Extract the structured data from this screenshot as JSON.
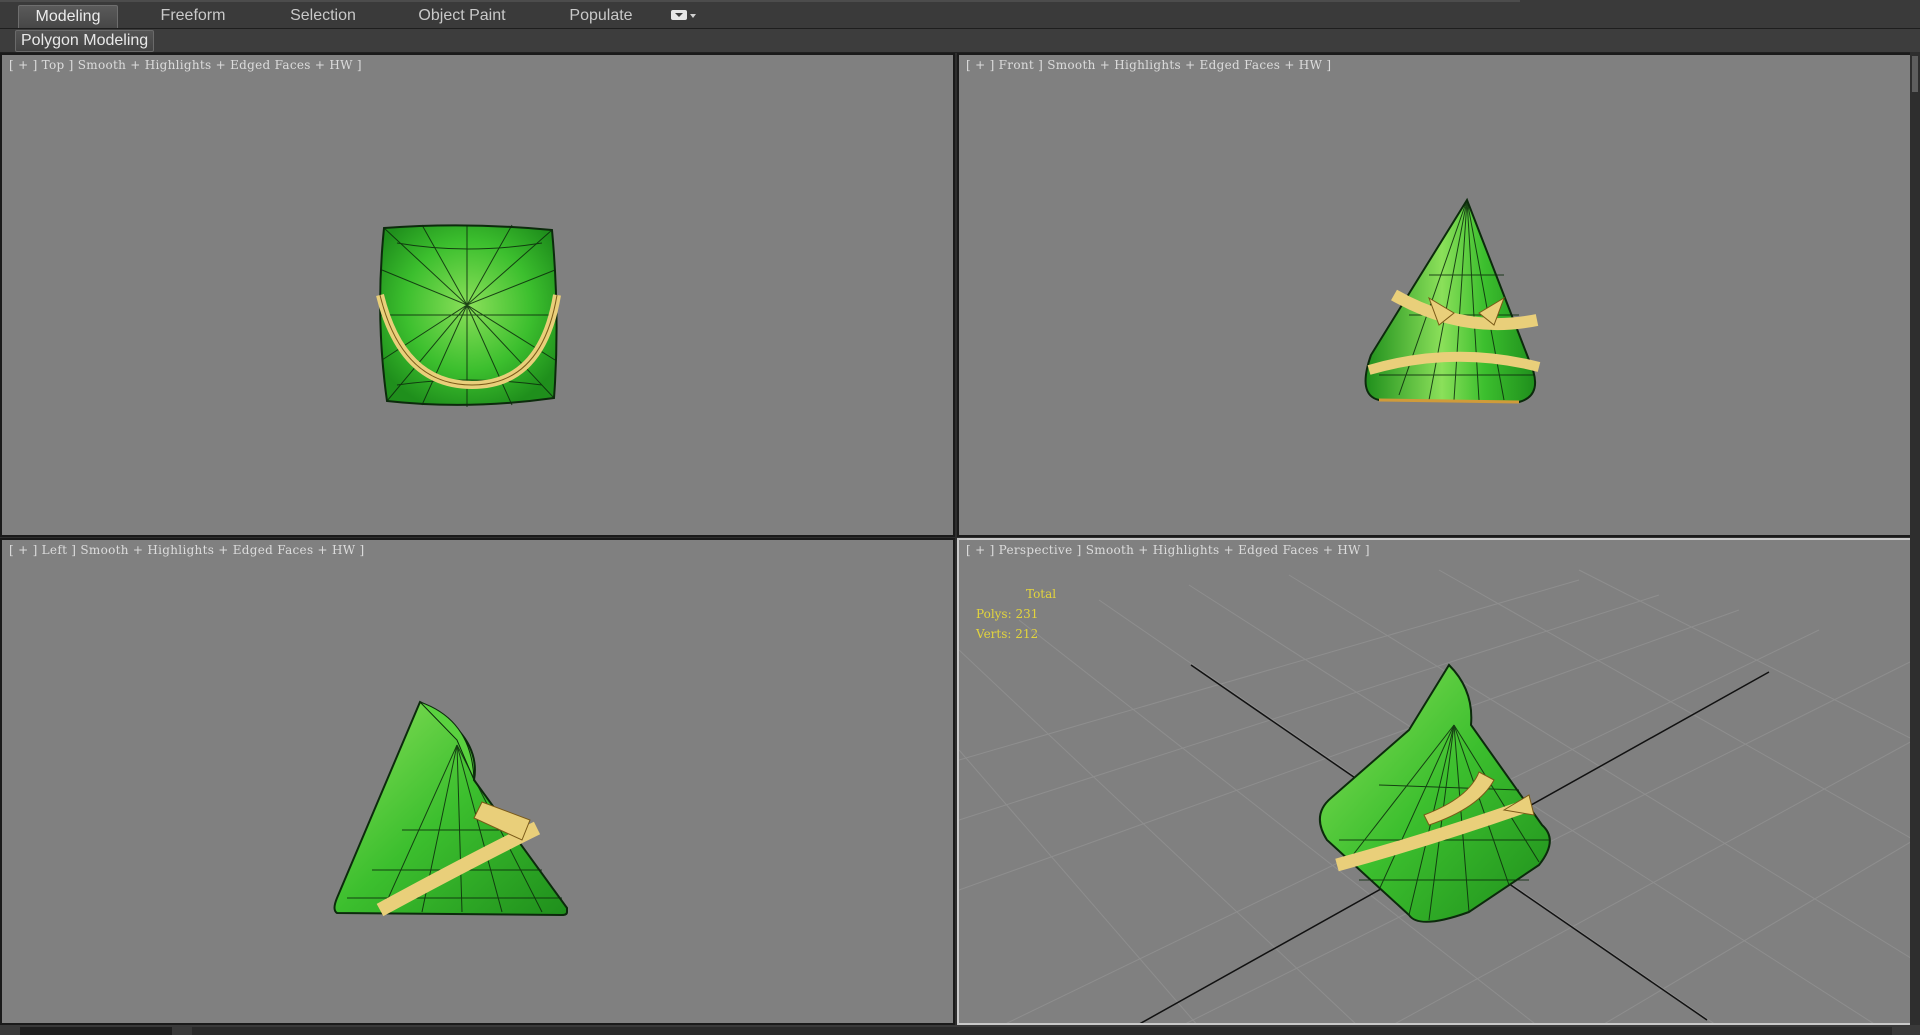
{
  "ribbon": {
    "tabs": [
      {
        "label": "Modeling",
        "active": true
      },
      {
        "label": "Freeform",
        "active": false
      },
      {
        "label": "Selection",
        "active": false
      },
      {
        "label": "Object Paint",
        "active": false
      },
      {
        "label": "Populate",
        "active": false
      }
    ],
    "panel_label": "Polygon Modeling"
  },
  "viewports": {
    "top": {
      "label": "[ + ] Top ] Smooth + Highlights + Edged Faces + HW ]"
    },
    "front": {
      "label": "[ + ] Front ] Smooth + Highlights + Edged Faces + HW ]"
    },
    "left": {
      "label": "[ + ] Left ] Smooth + Highlights + Edged Faces + HW ]"
    },
    "perspective": {
      "label": "[ + ] Perspective ] Smooth + Highlights + Edged Faces + HW ]",
      "stats": {
        "title": "Total",
        "polys": "Polys: 231",
        "verts": "Verts: 212"
      }
    }
  },
  "colors": {
    "viewport_bg": "#808080",
    "mesh_green": "#3cbf2e",
    "mesh_green_light": "#8be05a",
    "ribbon_yellow": "#e9cf7a",
    "stats_yellow": "#e2d43d",
    "active_border": "#c9c9c9"
  },
  "icons": {
    "tab_menu": "dropdown-menu-icon"
  }
}
